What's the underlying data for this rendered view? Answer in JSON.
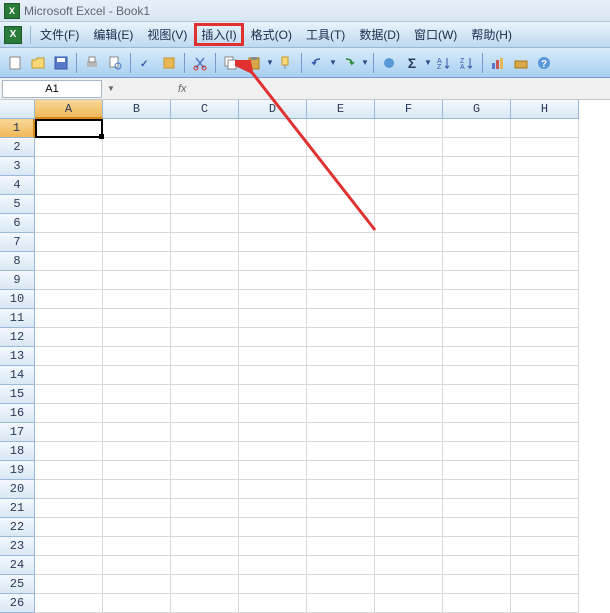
{
  "titlebar": {
    "app": "Microsoft Excel",
    "doc": "Book1"
  },
  "menus": {
    "file": "文件(F)",
    "edit": "编辑(E)",
    "view": "视图(V)",
    "insert": "插入(I)",
    "format": "格式(O)",
    "tools": "工具(T)",
    "data": "数据(D)",
    "window": "窗口(W)",
    "help": "帮助(H)"
  },
  "namebox": {
    "value": "A1"
  },
  "formula": {
    "fx": "fx"
  },
  "columns": [
    "A",
    "B",
    "C",
    "D",
    "E",
    "F",
    "G",
    "H"
  ],
  "rows": [
    1,
    2,
    3,
    4,
    5,
    6,
    7,
    8,
    9,
    10,
    11,
    12,
    13,
    14,
    15,
    16,
    17,
    18,
    19,
    20,
    21,
    22,
    23,
    24,
    25,
    26
  ],
  "selected": {
    "col": "A",
    "row": 1
  },
  "icons": {
    "sigma": "Σ"
  }
}
